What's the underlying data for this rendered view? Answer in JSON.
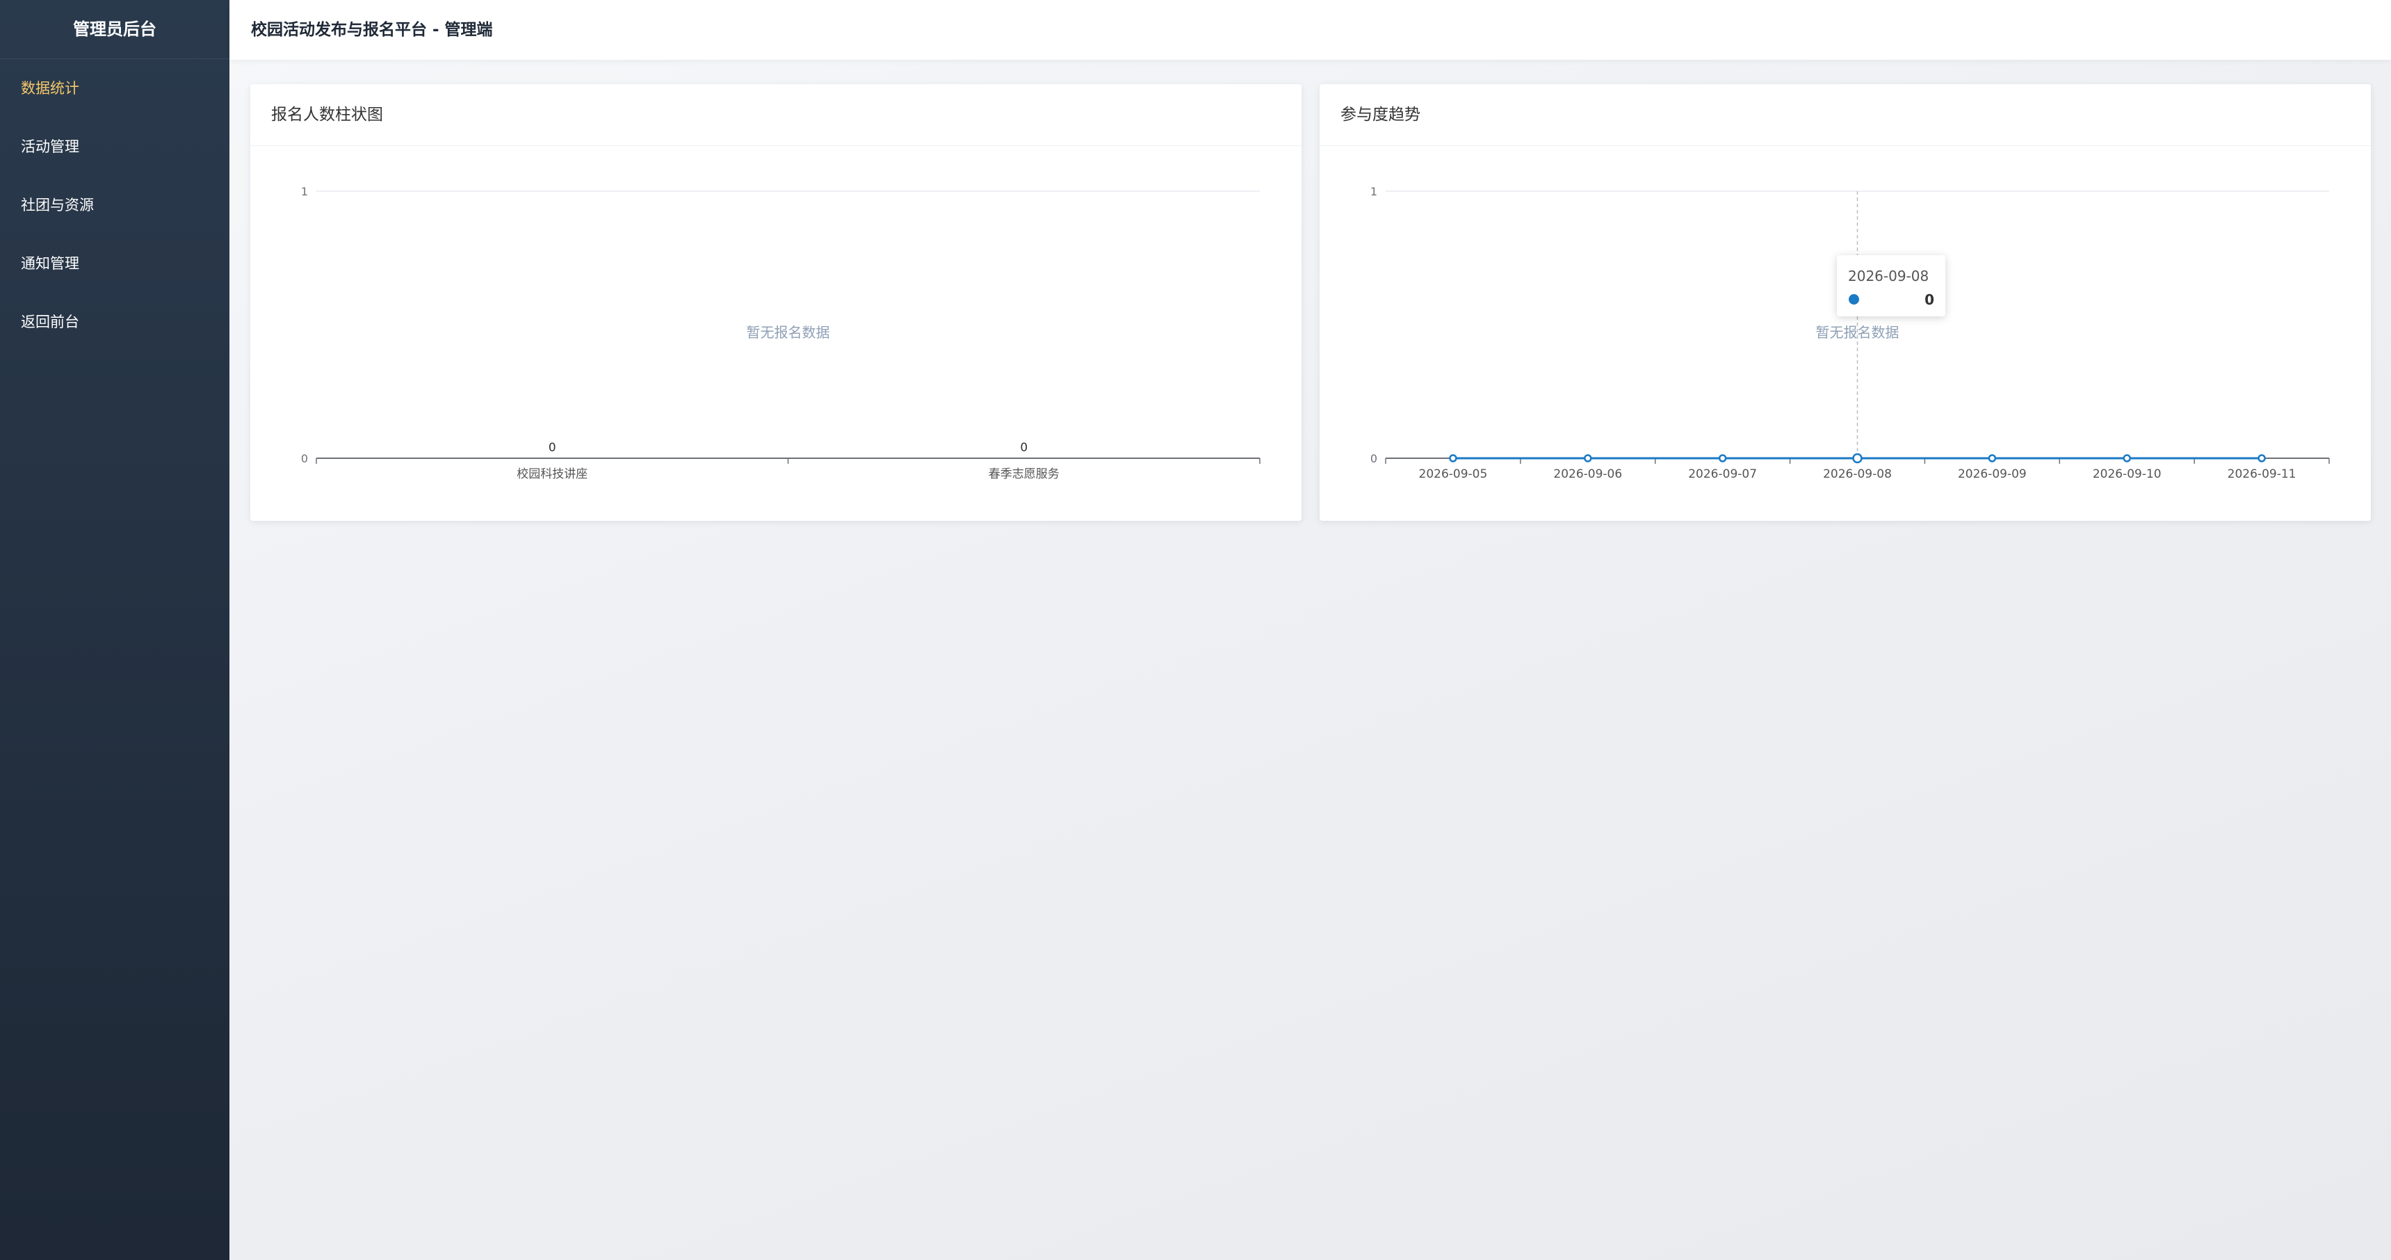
{
  "sidebar": {
    "title": "管理员后台",
    "items": [
      {
        "label": "数据统计",
        "active": true
      },
      {
        "label": "活动管理",
        "active": false
      },
      {
        "label": "社团与资源",
        "active": false
      },
      {
        "label": "通知管理",
        "active": false
      },
      {
        "label": "返回前台",
        "active": false
      }
    ]
  },
  "header": {
    "title": "校园活动发布与报名平台 - 管理端"
  },
  "colors": {
    "sidebar_active": "#f5c76b",
    "series_line": "#1a7ac4",
    "empty_text": "#8fa0b5"
  },
  "charts": {
    "bar": {
      "title": "报名人数柱状图",
      "empty_text": "暂无报名数据"
    },
    "line": {
      "title": "参与度趋势",
      "empty_text": "暂无报名数据"
    }
  },
  "tooltip": {
    "date": "2026-09-08",
    "value": "0"
  },
  "chart_data": [
    {
      "type": "bar",
      "title": "报名人数柱状图",
      "categories": [
        "校园科技讲座",
        "春季志愿服务"
      ],
      "values": [
        0,
        0
      ],
      "data_labels": [
        "0",
        "0"
      ],
      "ylim": [
        0,
        1
      ],
      "yticks": [
        "0",
        "1"
      ],
      "grid": true
    },
    {
      "type": "line",
      "title": "参与度趋势",
      "x": [
        "2026-09-05",
        "2026-09-06",
        "2026-09-07",
        "2026-09-08",
        "2026-09-09",
        "2026-09-10",
        "2026-09-11"
      ],
      "values": [
        0,
        0,
        0,
        0,
        0,
        0,
        0
      ],
      "ylim": [
        0,
        1
      ],
      "yticks": [
        "0",
        "1"
      ],
      "grid": true
    }
  ]
}
